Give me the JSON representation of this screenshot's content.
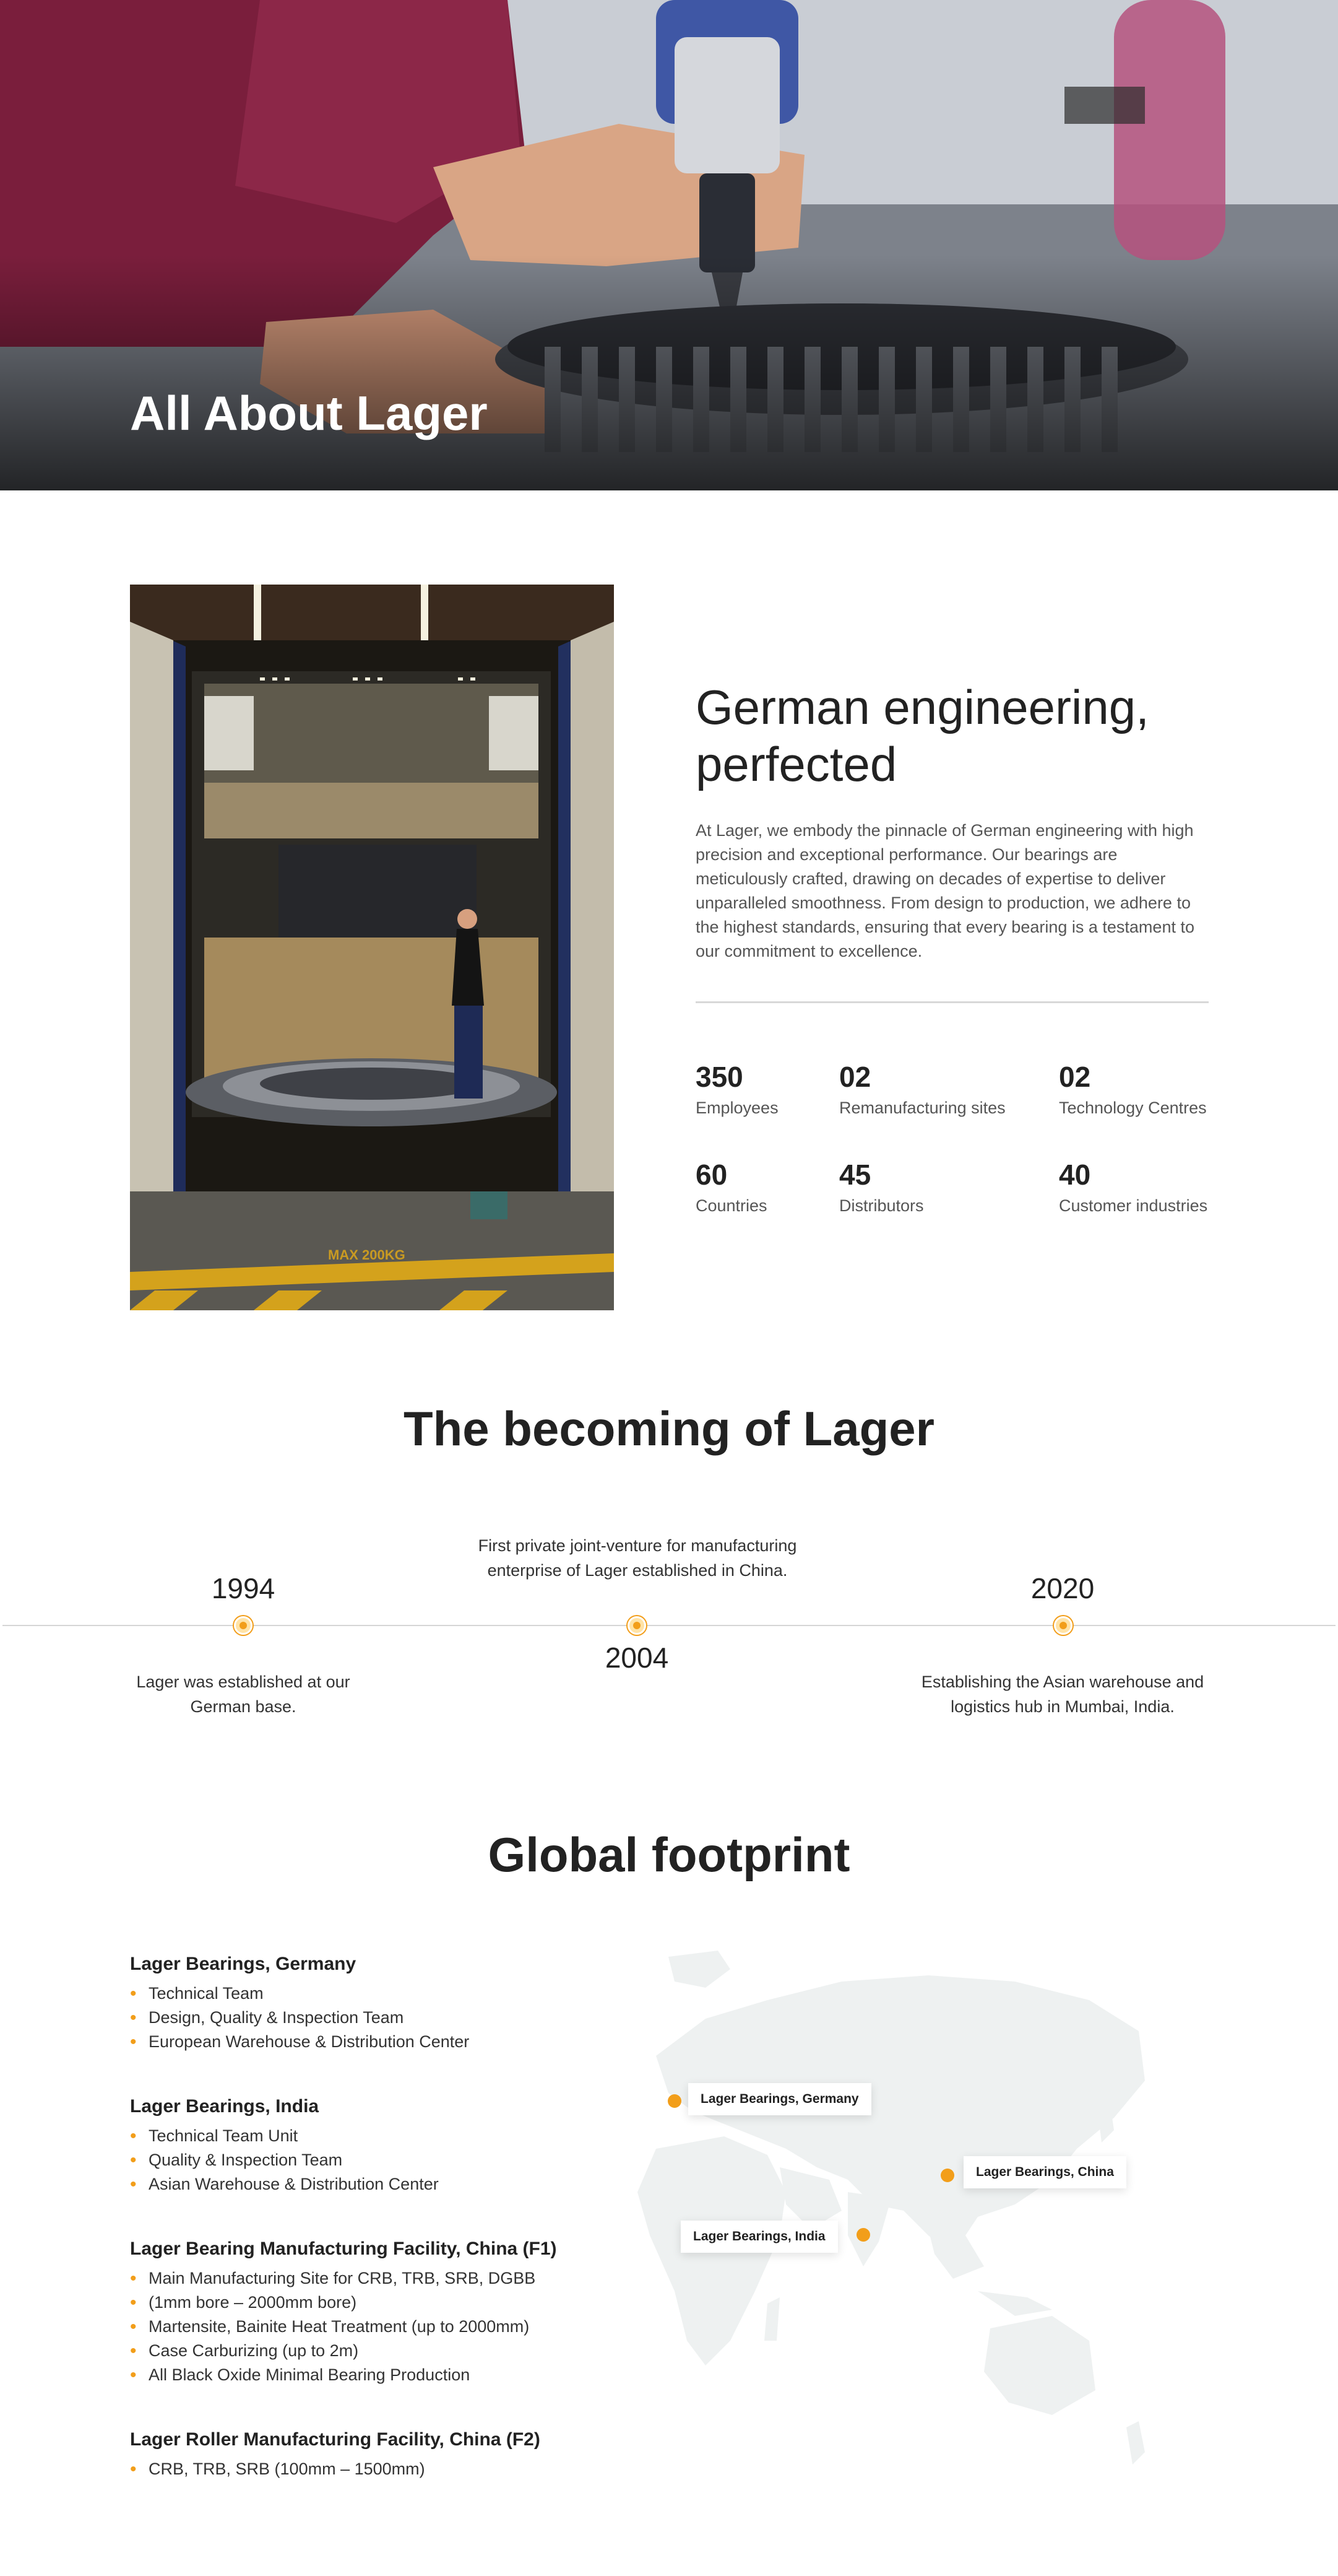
{
  "hero": {
    "title": "All About Lager"
  },
  "about": {
    "heading": "German engineering, perfected",
    "text": "At Lager, we embody the pinnacle of German engineering with high precision and exceptional performance. Our bearings are meticulously crafted, drawing on decades of expertise to deliver unparalleled smoothness. From design to production, we adhere to the highest standards, ensuring that every bearing is a testament to our commitment to excellence.",
    "photo_floor_text": "MAX 200KG",
    "stats": [
      {
        "value": "350",
        "label": "Employees"
      },
      {
        "value": "02",
        "label": "Remanufacturing sites"
      },
      {
        "value": "02",
        "label": "Technology Centres"
      },
      {
        "value": "60",
        "label": "Countries"
      },
      {
        "value": "45",
        "label": "Distributors"
      },
      {
        "value": "40",
        "label": "Customer industries"
      }
    ]
  },
  "timeline": {
    "title": "The becoming of Lager",
    "events": [
      {
        "year": "1994",
        "text": "Lager was established at our German base."
      },
      {
        "year": "2004",
        "text": "First private joint-venture for manufacturing enterprise of Lager established in China."
      },
      {
        "year": "2020",
        "text": "Establishing the Asian warehouse and logistics hub in Mumbai, India."
      }
    ]
  },
  "footprint": {
    "title": "Global footprint",
    "locations": [
      {
        "name": "Lager Bearings, Germany",
        "items": [
          "Technical Team",
          "Design, Quality & Inspection Team",
          "European Warehouse & Distribution Center"
        ]
      },
      {
        "name": "Lager Bearings, India",
        "items": [
          "Technical Team Unit",
          "Quality & Inspection Team",
          "Asian Warehouse & Distribution Center"
        ]
      },
      {
        "name": "Lager Bearing Manufacturing Facility, China  (F1)",
        "items": [
          "Main Manufacturing Site for CRB, TRB, SRB, DGBB",
          "(1mm bore – 2000mm bore)",
          "Martensite, Bainite Heat Treatment (up to 2000mm)",
          "Case Carburizing (up to 2m)",
          "All Black Oxide Minimal Bearing Production"
        ]
      },
      {
        "name": "Lager Roller Manufacturing Facility, China (F2)",
        "items": [
          "CRB, TRB, SRB (100mm – 1500mm)"
        ]
      }
    ],
    "map_labels": {
      "germany": "Lager Bearings, Germany",
      "china": "Lager Bearings, China",
      "india": "Lager Bearings, India"
    }
  },
  "colors": {
    "accent": "#f29e1a",
    "text": "#222222",
    "muted": "#555555",
    "map": "#eef1f1"
  }
}
